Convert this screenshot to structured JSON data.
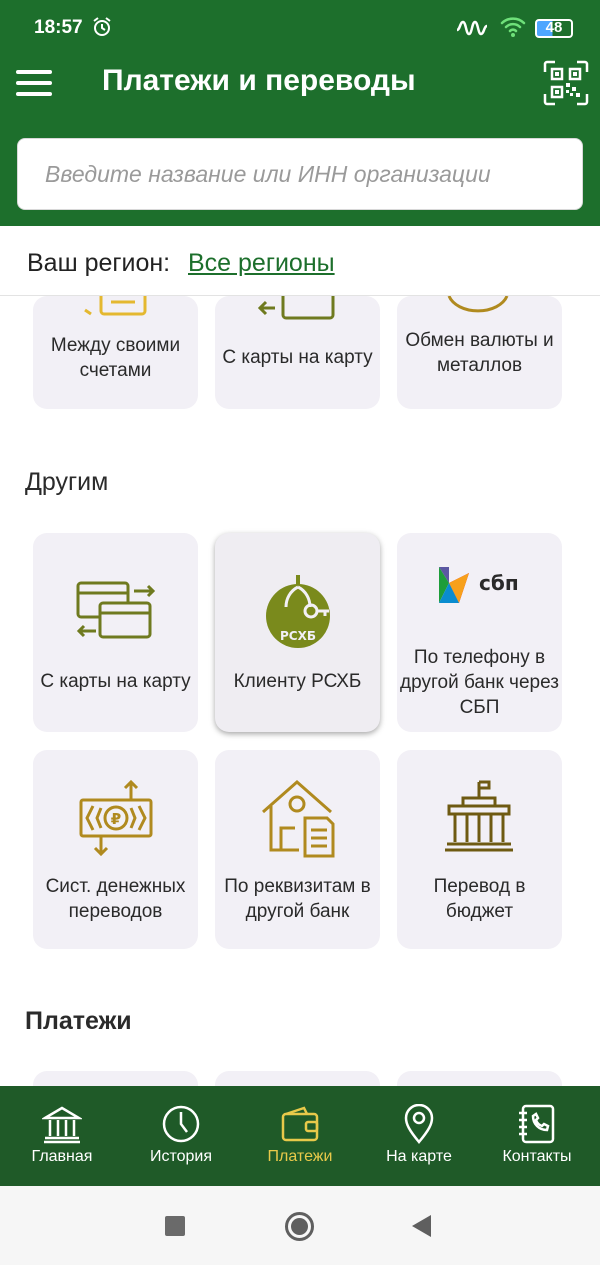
{
  "status": {
    "time": "18:57",
    "battery": "48"
  },
  "header": {
    "title": "Платежи и переводы"
  },
  "search": {
    "placeholder": "Введите название или ИНН организации"
  },
  "region": {
    "label": "Ваш регион:",
    "value": "Все регионы"
  },
  "own": [
    {
      "label": "Между своими счетами",
      "icon": "accounts-transfer-icon"
    },
    {
      "label": "С карты на карту",
      "icon": "card-transfer-icon"
    },
    {
      "label": "Обмен валюты и металлов",
      "icon": "currency-exchange-icon"
    }
  ],
  "others": {
    "title": "Другим",
    "items": [
      {
        "label": "С карты на карту",
        "icon": "card-to-card-icon"
      },
      {
        "label": "Клиенту РСХБ",
        "icon": "rshb-logo-icon",
        "logo_text": "РСХБ"
      },
      {
        "label": "По телефону в другой банк через СБП",
        "icon": "sbp-logo-icon",
        "logo_text": "сбп"
      },
      {
        "label": "Сист. денежных переводов",
        "icon": "money-transfer-system-icon"
      },
      {
        "label": "По реквизитам в другой банк",
        "icon": "bank-details-icon"
      },
      {
        "label": "Перевод в бюджет",
        "icon": "government-building-icon"
      }
    ]
  },
  "payments": {
    "title": "Платежи"
  },
  "nav": [
    {
      "label": "Главная",
      "icon": "bank-icon"
    },
    {
      "label": "История",
      "icon": "clock-icon"
    },
    {
      "label": "Платежи",
      "icon": "wallet-icon",
      "active": true
    },
    {
      "label": "На карте",
      "icon": "location-pin-icon"
    },
    {
      "label": "Контакты",
      "icon": "contacts-phone-icon"
    }
  ],
  "colors": {
    "brand_green": "#1d6f2c",
    "nav_green": "#1f5a28",
    "accent_gold": "#e8c94a",
    "icon_olive": "#6f7a1f",
    "icon_gold": "#b08a1f"
  }
}
